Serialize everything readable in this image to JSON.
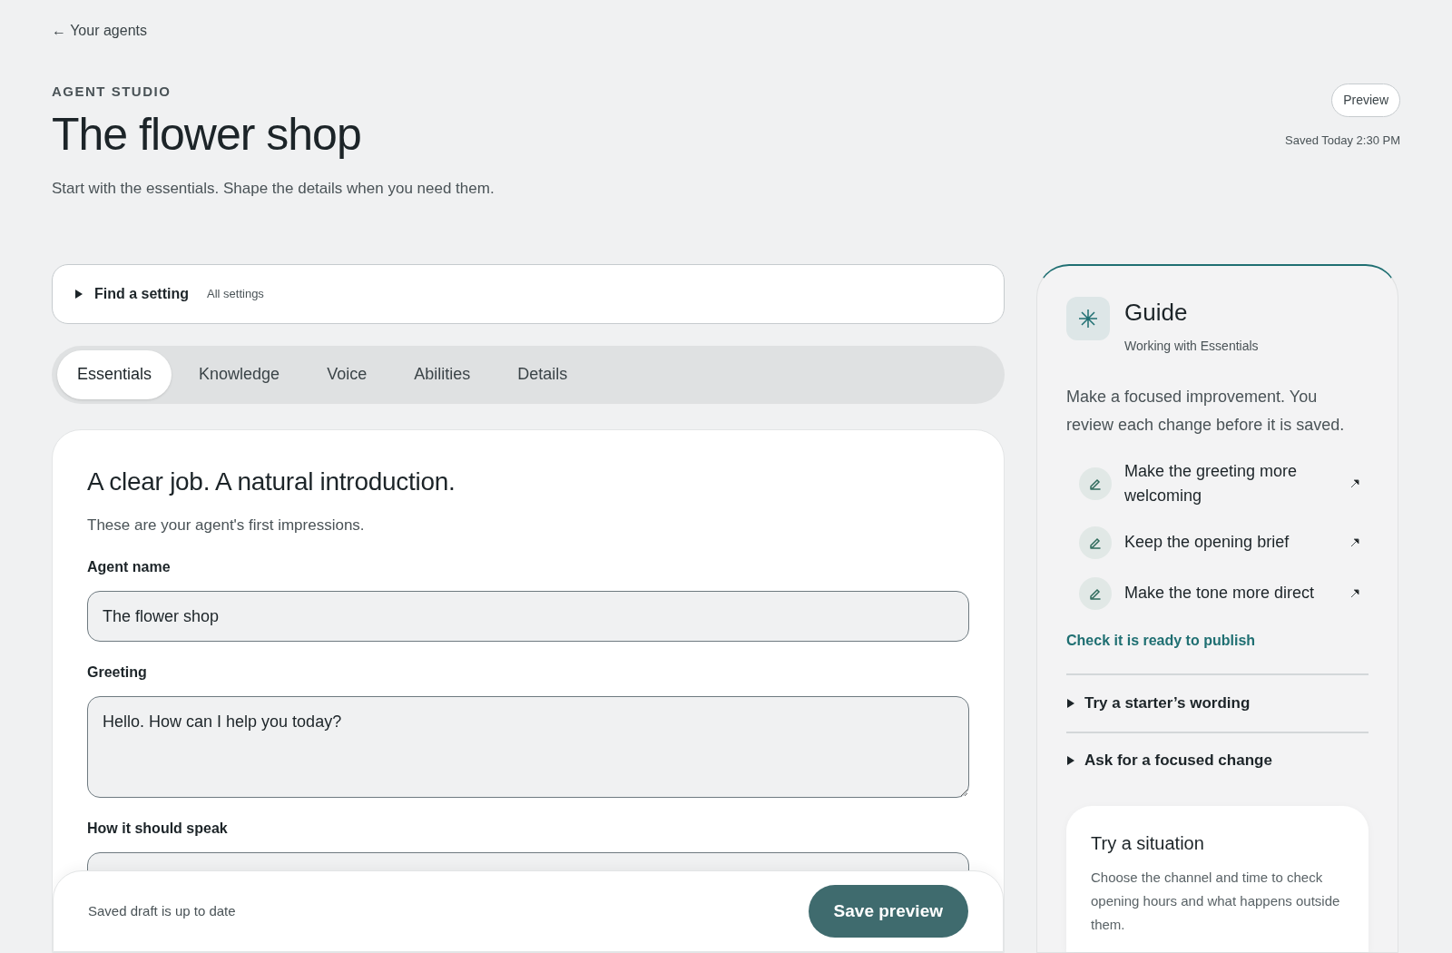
{
  "back_link": "← Your agents",
  "eyebrow": "AGENT STUDIO",
  "title": "The flower shop",
  "subtitle": "Start with the essentials. Shape the details when you need them.",
  "preview_button": "Preview",
  "saved_status": "Saved Today 2:30 PM",
  "finder": {
    "label": "Find a setting",
    "hint": "All settings",
    "expanded": false
  },
  "tabs": [
    {
      "label": "Essentials",
      "selected": true
    },
    {
      "label": "Knowledge",
      "selected": false
    },
    {
      "label": "Voice",
      "selected": false
    },
    {
      "label": "Abilities",
      "selected": false
    },
    {
      "label": "Details",
      "selected": false
    }
  ],
  "section": {
    "heading": "A clear job. A natural introduction.",
    "description": "These are your agent's first impressions.",
    "fields": [
      {
        "kind": "input",
        "label": "Agent name",
        "value": "The flower shop"
      },
      {
        "kind": "textarea",
        "label": "Greeting",
        "value": "Hello. How can I help you today?"
      },
      {
        "kind": "textarea",
        "label": "How it should speak"
      }
    ]
  },
  "footer": {
    "status": "Saved draft is up to date",
    "button": "Save preview"
  },
  "guide": {
    "title": "Guide",
    "subtitle": "Working with Essentials",
    "intro": "Make a focused improvement. You review each change before it is saved.",
    "suggestions": [
      "Make the greeting more welcoming",
      "Keep the opening brief",
      "Make the tone more direct"
    ],
    "link": "Check it is ready to publish",
    "sections": [
      {
        "label": "Try a starter’s wording",
        "expanded": false
      },
      {
        "label": "Ask for a focused change",
        "expanded": false
      }
    ],
    "situation": {
      "title": "Try a situation",
      "text": "Choose the channel and time to check opening hours and what happens outside them."
    }
  }
}
